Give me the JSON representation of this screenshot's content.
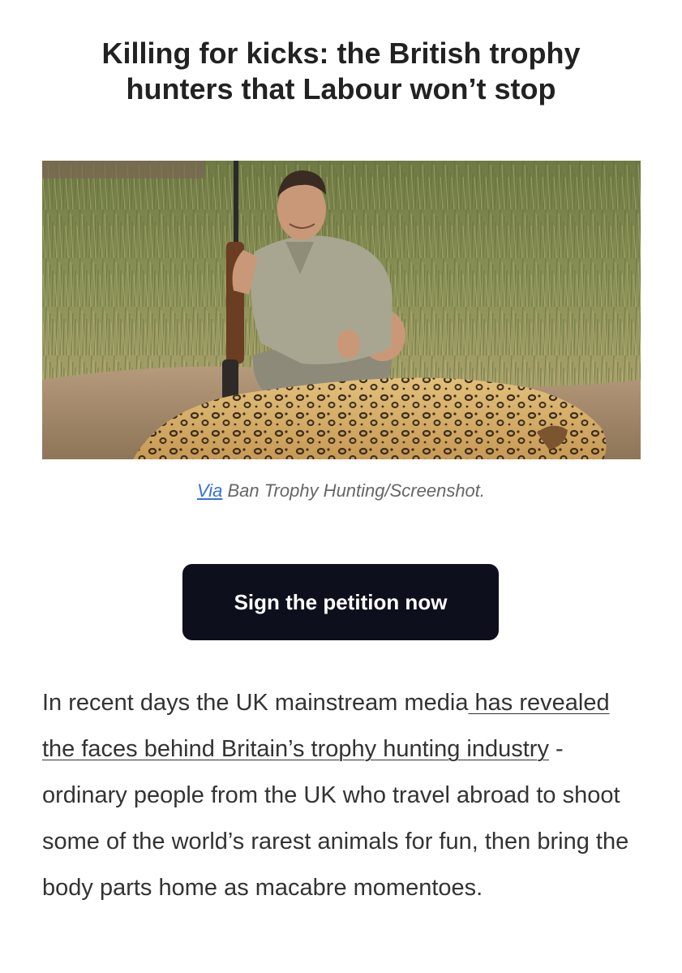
{
  "article": {
    "headline": "Killing for kicks: the British trophy hunters that Labour won’t stop",
    "image": {
      "subject": "hunter-with-leopard-photo"
    },
    "caption": {
      "link_text": "Via",
      "credit_text": " Ban Trophy Hunting/Screenshot."
    },
    "cta_button": {
      "label": "Sign the petition now",
      "background_color": "#0d0f1c",
      "text_color": "#ffffff"
    },
    "body": {
      "intro": "In recent days the UK mainstream media",
      "link_text": " has revealed the faces behind Britain’s trophy hunting industry",
      "rest": " - ordinary people from the UK who travel abroad to shoot some of the world’s rarest animals for fun, then bring the body parts home as macabre momentoes."
    },
    "colors": {
      "link_blue": "#3a6fd8",
      "caption_gray": "#666666",
      "body_text": "#333333"
    }
  }
}
